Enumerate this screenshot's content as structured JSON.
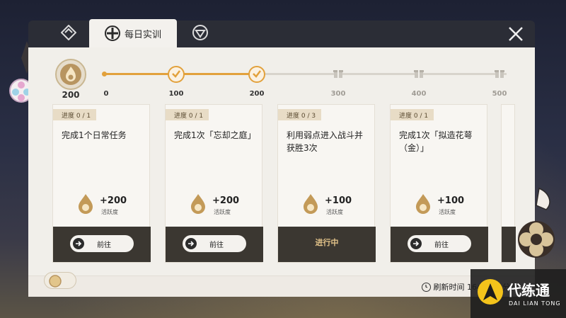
{
  "tabs": [
    {
      "label": "",
      "icon": "diamond-emblem-icon"
    },
    {
      "label": "每日实训",
      "icon": "training-wheel-icon"
    },
    {
      "label": "",
      "icon": "shield-badge-icon"
    }
  ],
  "progress": {
    "current_value": "200",
    "current_fraction": 0.4,
    "milestones": [
      {
        "label": "0",
        "state": "start"
      },
      {
        "label": "100",
        "state": "claimed"
      },
      {
        "label": "200",
        "state": "claimed"
      },
      {
        "label": "300",
        "state": "locked"
      },
      {
        "label": "400",
        "state": "locked"
      },
      {
        "label": "500",
        "state": "locked"
      }
    ],
    "accent_color": "#e2a13c"
  },
  "cards": [
    {
      "tag": "进度  0 / 1",
      "title": "完成1个日常任务",
      "reward": "+200",
      "reward_label": "活跃度",
      "action": "前往",
      "state": "go"
    },
    {
      "tag": "进度  0 / 1",
      "title": "完成1次「忘却之庭」",
      "reward": "+200",
      "reward_label": "活跃度",
      "action": "前往",
      "state": "go"
    },
    {
      "tag": "进度  0 / 3",
      "title": "利用弱点进入战斗并获胜3次",
      "reward": "+100",
      "reward_label": "活跃度",
      "action": "进行中",
      "state": "in-progress"
    },
    {
      "tag": "进度  0 / 1",
      "title": "完成1次「拟造花萼（金）」",
      "reward": "+100",
      "reward_label": "活跃度",
      "action": "前往",
      "state": "go"
    }
  ],
  "footer": {
    "refresh_text": "刷新时间 16小时49分钟"
  },
  "watermark": {
    "title": "代练通",
    "subtitle": "DAI LIAN TONG"
  }
}
